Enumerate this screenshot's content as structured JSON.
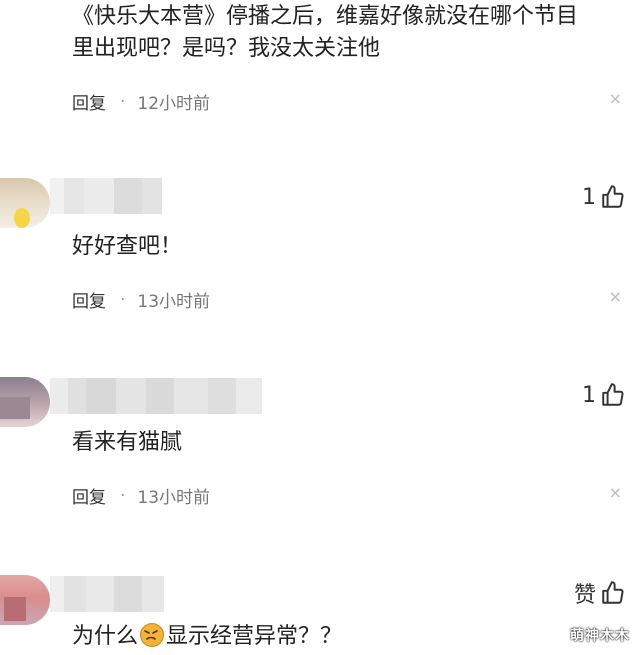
{
  "comments": [
    {
      "text_lines": [
        "《快乐大本营》停播之后，维嘉好像就没在哪个节目",
        "里出现吧？是吗？我没太关注他"
      ],
      "reply_label": "回复",
      "separator": "·",
      "time": "12小时前",
      "close_glyph": "×"
    },
    {
      "text": "好好查吧！",
      "reply_label": "回复",
      "separator": "·",
      "time": "13小时前",
      "close_glyph": "×",
      "likes": "1"
    },
    {
      "text": "看来有猫腻",
      "reply_label": "回复",
      "separator": "·",
      "time": "13小时前",
      "close_glyph": "×",
      "likes": "1"
    },
    {
      "text_before": "为什么",
      "text_after": "显示经营异常？？",
      "emoji": "angry-face-icon",
      "likes": "赞"
    }
  ],
  "watermark": "萌神木木"
}
